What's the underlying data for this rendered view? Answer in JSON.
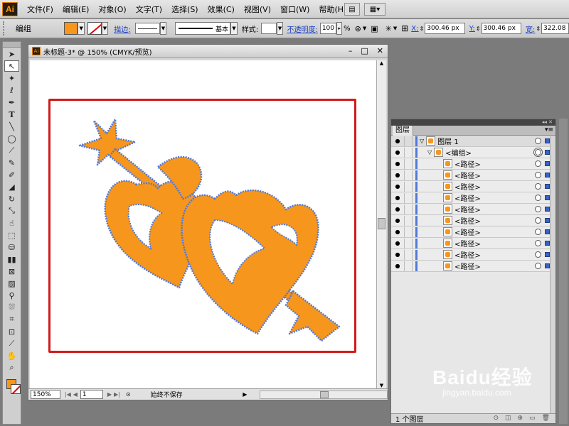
{
  "app": {
    "logo": "Ai"
  },
  "menu": [
    "文件(F)",
    "编辑(E)",
    "对象(O)",
    "文字(T)",
    "选择(S)",
    "效果(C)",
    "视图(V)",
    "窗口(W)",
    "帮助(H)"
  ],
  "controlbar": {
    "selection_label": "编组",
    "stroke_label": "描边:",
    "line_style": "基本",
    "style_label": "样式:",
    "opacity_label": "不透明度:",
    "opacity_value": "100",
    "opacity_unit": "%",
    "x_label": "X:",
    "x_value": "300.46 px",
    "y_label": "Y:",
    "y_value": "300.46 px",
    "width_label": "宽:",
    "width_value": "322.08 p"
  },
  "colors": {
    "fill": "#f7961d",
    "artboard_border": "#d11a1a",
    "path_outline": "#4f79d8",
    "layer_color": "#4f79d8"
  },
  "tools": [
    "selection-tool",
    "direct-selection-tool",
    "magic-wand-tool",
    "lasso-tool",
    "pen-tool",
    "type-tool",
    "line-tool",
    "ellipse-tool",
    "paintbrush-tool",
    "pencil-tool",
    "blob-brush-tool",
    "eraser-tool",
    "rotate-tool",
    "scale-tool",
    "warp-tool",
    "free-transform-tool",
    "symbol-sprayer-tool",
    "column-graph-tool",
    "mesh-tool",
    "gradient-tool",
    "eyedropper-tool",
    "live-paint-tool",
    "live-paint-selection-tool",
    "crop-tool",
    "slice-tool",
    "hand-tool",
    "zoom-tool"
  ],
  "document": {
    "title": "未标题-3* @ 150% (CMYK/预览)",
    "zoom": "150%",
    "page": "1",
    "save_status": "始终不保存"
  },
  "layers_panel": {
    "tab": "图层",
    "rows": [
      {
        "name": "图层 1",
        "level": 0,
        "expanded": true
      },
      {
        "name": "<编组>",
        "level": 1,
        "expanded": true
      },
      {
        "name": "<路径>",
        "level": 2
      },
      {
        "name": "<路径>",
        "level": 2
      },
      {
        "name": "<路径>",
        "level": 2
      },
      {
        "name": "<路径>",
        "level": 2
      },
      {
        "name": "<路径>",
        "level": 2
      },
      {
        "name": "<路径>",
        "level": 2
      },
      {
        "name": "<路径>",
        "level": 2
      },
      {
        "name": "<路径>",
        "level": 2
      },
      {
        "name": "<路径>",
        "level": 2
      },
      {
        "name": "<路径>",
        "level": 2
      }
    ],
    "footer": "1 个图层"
  },
  "watermark": {
    "main": "Baidu经验",
    "sub": "jingyan.baidu.com"
  }
}
